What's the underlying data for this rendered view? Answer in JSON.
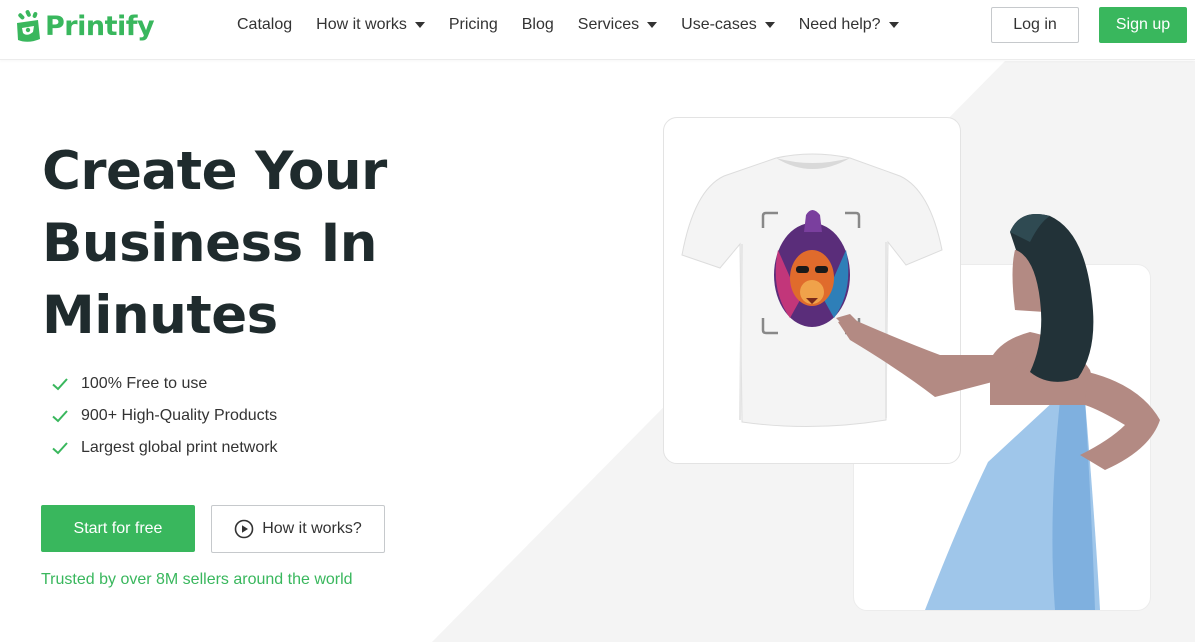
{
  "brand": {
    "name": "Printify",
    "color": "#39b75d",
    "icon": "printify-logo-icon"
  },
  "nav": {
    "items": [
      {
        "label": "Catalog",
        "dropdown": false
      },
      {
        "label": "How it works",
        "dropdown": true
      },
      {
        "label": "Pricing",
        "dropdown": false
      },
      {
        "label": "Blog",
        "dropdown": false
      },
      {
        "label": "Services",
        "dropdown": true
      },
      {
        "label": "Use-cases",
        "dropdown": true
      },
      {
        "label": "Need help?",
        "dropdown": true
      }
    ],
    "login_label": "Log in",
    "signup_label": "Sign up"
  },
  "hero": {
    "title_lines": [
      "Create Your",
      "Business In",
      "Minutes"
    ],
    "features": [
      "100% Free to use",
      "900+ High-Quality Products",
      "Largest global print network"
    ],
    "primary_cta": "Start for free",
    "secondary_cta": "How it works?",
    "trusted_text": "Trusted by over 8M sellers around the world"
  },
  "colors": {
    "accent": "#39b75d",
    "title": "#1f2b2d",
    "skin": "#b38a83",
    "dress": "#9fc6ea",
    "hair": "#223238"
  }
}
